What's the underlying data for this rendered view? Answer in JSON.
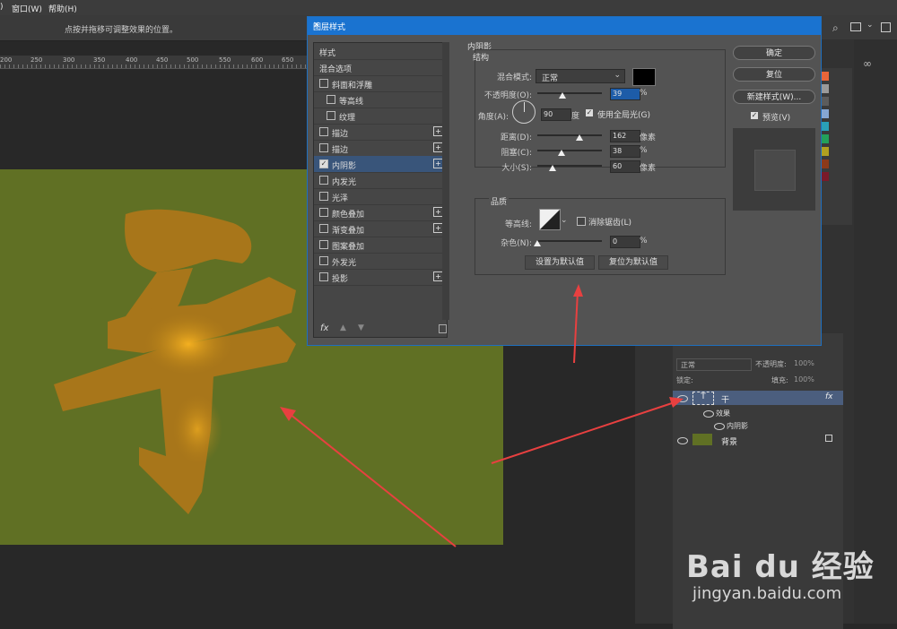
{
  "menubar": {
    "items": [
      "窗口(W)",
      "帮助(H)"
    ],
    "first_fragment": ")"
  },
  "optionsbar": {
    "hint": "点按并拖移可调整效果的位置。"
  },
  "ruler": {
    "ticks": [
      "200",
      "250",
      "300",
      "350",
      "400",
      "450",
      "500",
      "550",
      "600",
      "650"
    ]
  },
  "dialog": {
    "title": "图层样式",
    "close_icon": "close-icon",
    "style_list": {
      "header1": "样式",
      "header2": "混合选项",
      "items": [
        {
          "label": "斜面和浮雕",
          "checked": false,
          "plus": false,
          "indent": false
        },
        {
          "label": "等高线",
          "checked": false,
          "plus": false,
          "indent": true
        },
        {
          "label": "纹理",
          "checked": false,
          "plus": false,
          "indent": true
        },
        {
          "label": "描边",
          "checked": false,
          "plus": true,
          "indent": false
        },
        {
          "label": "描边",
          "checked": false,
          "plus": true,
          "indent": false
        },
        {
          "label": "内阴影",
          "checked": true,
          "plus": true,
          "indent": false,
          "selected": true
        },
        {
          "label": "内发光",
          "checked": false,
          "plus": false,
          "indent": false
        },
        {
          "label": "光泽",
          "checked": false,
          "plus": false,
          "indent": false
        },
        {
          "label": "颜色叠加",
          "checked": false,
          "plus": true,
          "indent": false
        },
        {
          "label": "渐变叠加",
          "checked": false,
          "plus": true,
          "indent": false
        },
        {
          "label": "图案叠加",
          "checked": false,
          "plus": false,
          "indent": false
        },
        {
          "label": "外发光",
          "checked": false,
          "plus": false,
          "indent": false
        },
        {
          "label": "投影",
          "checked": false,
          "plus": true,
          "indent": false
        }
      ],
      "footer_fx": "fx"
    },
    "inner_shadow": {
      "section_title": "内阴影",
      "structure_title": "结构",
      "blend_mode_label": "混合模式:",
      "blend_mode_value": "正常",
      "shadow_color": "#000000",
      "opacity_label": "不透明度(O):",
      "opacity_value": "39",
      "opacity_unit": "%",
      "angle_label": "角度(A):",
      "angle_value": "90",
      "angle_unit": "度",
      "global_light_label": "使用全局光(G)",
      "global_light_checked": true,
      "distance_label": "距离(D):",
      "distance_value": "162",
      "distance_unit": "像素",
      "choke_label": "阻塞(C):",
      "choke_value": "38",
      "choke_unit": "%",
      "size_label": "大小(S):",
      "size_value": "60",
      "size_unit": "像素",
      "quality_title": "品质",
      "contour_label": "等高线:",
      "anti_alias_label": "消除锯齿(L)",
      "anti_alias_checked": false,
      "noise_label": "杂色(N):",
      "noise_value": "0",
      "noise_unit": "%",
      "make_default": "设置为默认值",
      "reset_default": "复位为默认值"
    },
    "buttons": {
      "ok": "确定",
      "reset": "复位",
      "new_style": "新建样式(W)...",
      "preview_label": "预览(V)",
      "preview_checked": true
    }
  },
  "layers": {
    "blend_mode": "正常",
    "opacity_label": "不透明度:",
    "opacity_value": "100%",
    "lock_label": "锁定:",
    "fill_label": "填充:",
    "fill_value": "100%",
    "rows": [
      {
        "name": "干",
        "type": "text",
        "fx": "fx"
      },
      {
        "name": "效果",
        "type": "effects-header"
      },
      {
        "name": "内阴影",
        "type": "effect"
      },
      {
        "name": "背景",
        "type": "background"
      }
    ]
  },
  "swatches": [
    "#e8653a",
    "#9a9a9a",
    "#5c5c5c",
    "#86a6d2",
    "#2aa0b8",
    "#23a05a",
    "#b0a020",
    "#8c3a1a",
    "#7a1a2a"
  ],
  "watermark": {
    "brand": "Bai du 经验",
    "url": "jingyan.baidu.com"
  }
}
